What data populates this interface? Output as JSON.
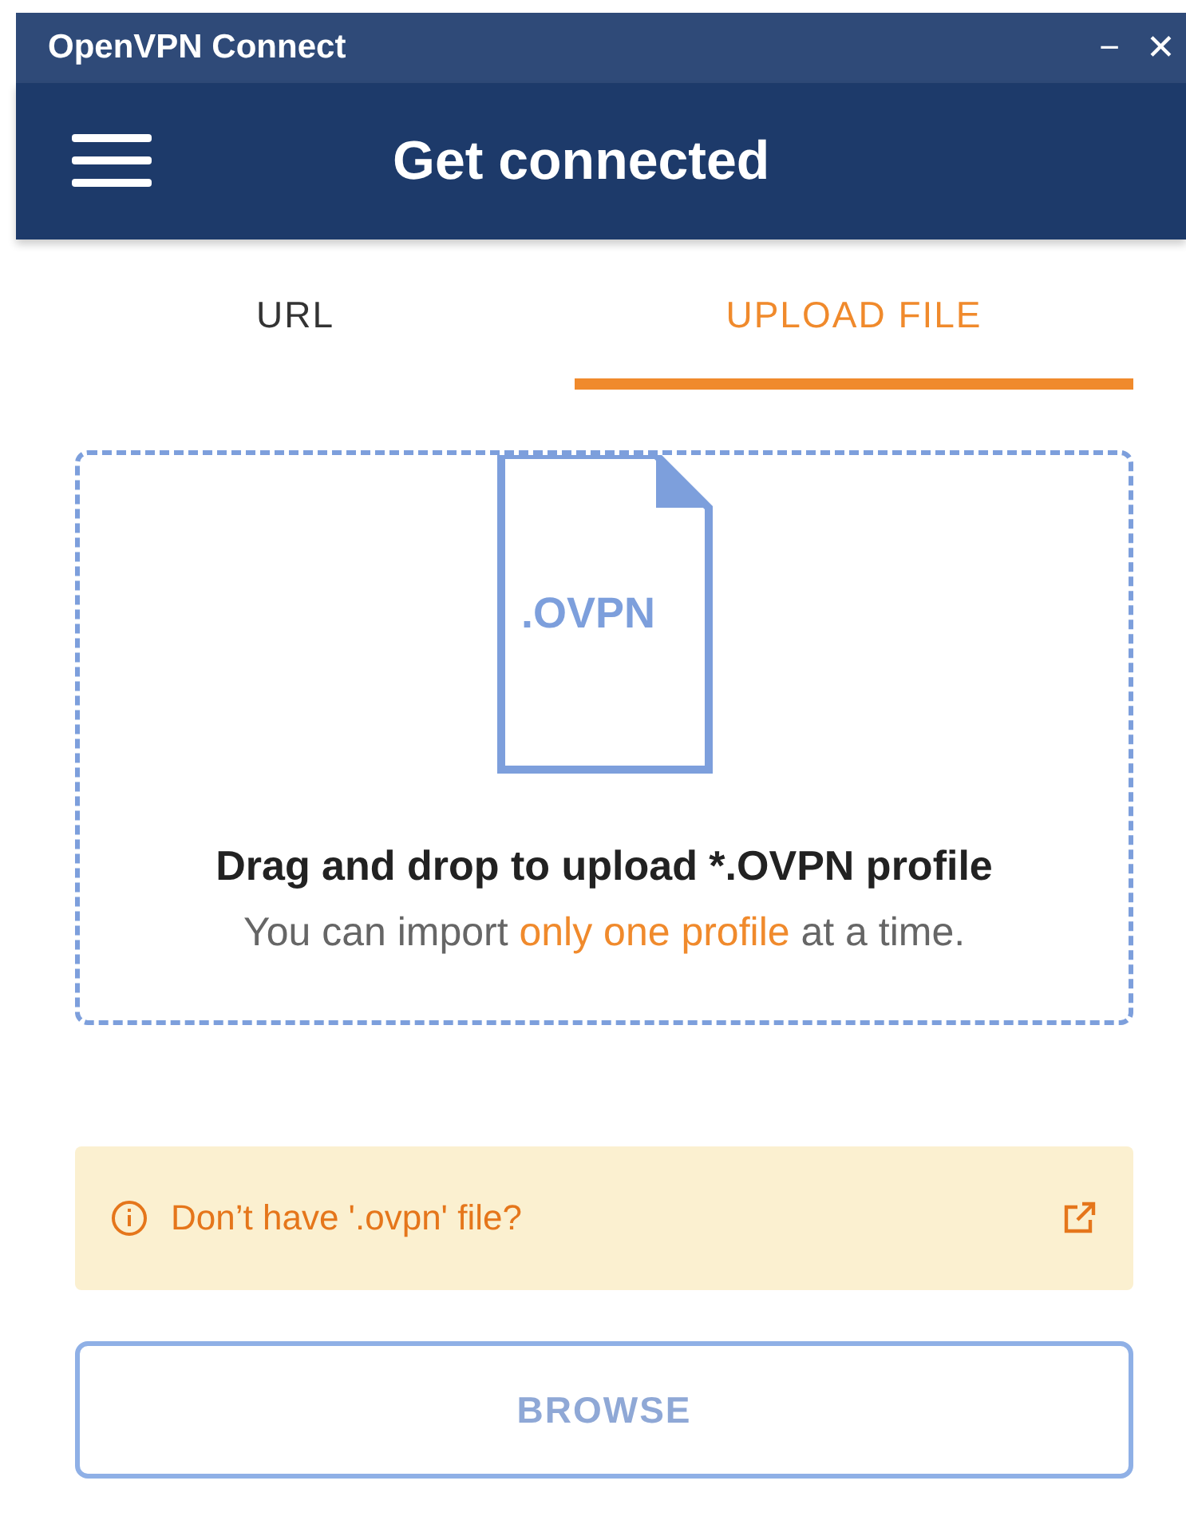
{
  "window": {
    "title": "OpenVPN Connect",
    "controls": [
      "−",
      "✕"
    ]
  },
  "header": {
    "title": "Get connected"
  },
  "tabs": [
    {
      "label": "URL",
      "selected": false
    },
    {
      "label": "UPLOAD FILE",
      "selected": true
    }
  ],
  "dropzone": {
    "file_label": ".OVPN",
    "title": "Drag and drop to upload *.OVPN profile",
    "hint_before": "You can import ",
    "hint_highlight": "only one profile",
    "hint_after": " at a time."
  },
  "notice": {
    "text": "Don’t have '.ovpn' file?"
  },
  "buttons": [
    {
      "label": "BROWSE",
      "disabled": true
    }
  ]
}
